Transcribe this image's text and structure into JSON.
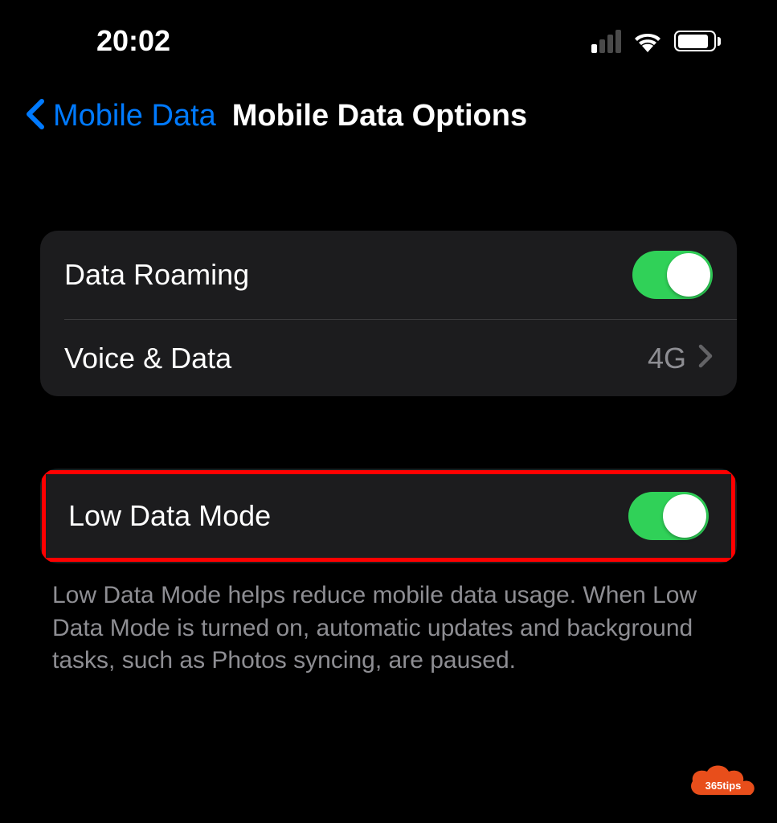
{
  "status_bar": {
    "time": "20:02"
  },
  "nav": {
    "back_label": "Mobile Data",
    "title": "Mobile Data Options"
  },
  "settings": {
    "data_roaming": {
      "label": "Data Roaming",
      "enabled": true
    },
    "voice_data": {
      "label": "Voice & Data",
      "value": "4G"
    },
    "low_data_mode": {
      "label": "Low Data Mode",
      "enabled": true
    }
  },
  "footer": {
    "low_data_description": "Low Data Mode helps reduce mobile data usage. When Low Data Mode is turned on, automatic updates and background tasks, such as Photos syncing, are paused."
  },
  "watermark": {
    "text": "365tips"
  }
}
